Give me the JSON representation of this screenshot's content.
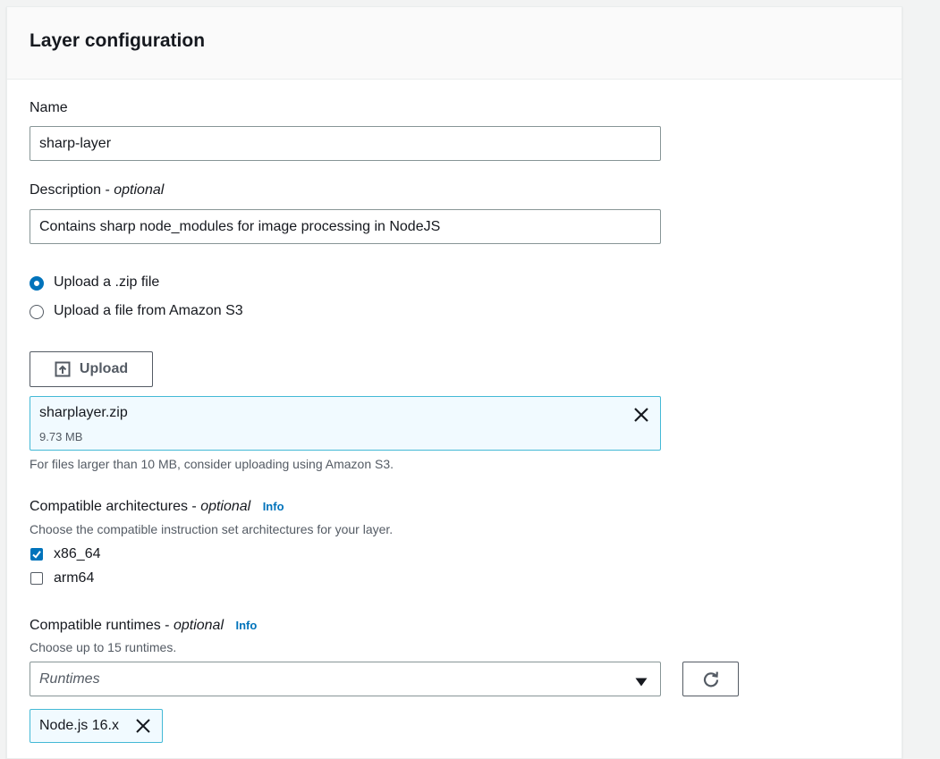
{
  "panel": {
    "title": "Layer configuration"
  },
  "name_field": {
    "label": "Name",
    "value": "sharp-layer"
  },
  "description_field": {
    "label": "Description - ",
    "optional": "optional",
    "value": "Contains sharp node_modules for image processing in NodeJS"
  },
  "upload_source": {
    "options": [
      {
        "label": "Upload a .zip file",
        "selected": true
      },
      {
        "label": "Upload a file from Amazon S3",
        "selected": false
      }
    ]
  },
  "upload_button": {
    "label": "Upload"
  },
  "uploaded_file": {
    "name": "sharplayer.zip",
    "size": "9.73 MB"
  },
  "upload_hint": "For files larger than 10 MB, consider uploading using Amazon S3.",
  "architectures": {
    "label": "Compatible architectures - ",
    "optional": "optional",
    "info": "Info",
    "description": "Choose the compatible instruction set architectures for your layer.",
    "options": [
      {
        "label": "x86_64",
        "checked": true
      },
      {
        "label": "arm64",
        "checked": false
      }
    ]
  },
  "runtimes": {
    "label": "Compatible runtimes - ",
    "optional": "optional",
    "info": "Info",
    "description": "Choose up to 15 runtimes.",
    "placeholder": "Runtimes",
    "selected": [
      "Node.js 16.x"
    ]
  },
  "colors": {
    "accent": "#0073bb",
    "token_border": "#44b9d6",
    "token_bg": "#f1faff"
  },
  "icons": {
    "upload": "upload-icon",
    "remove": "close-icon",
    "dropdown": "caret-down-icon",
    "refresh": "refresh-icon"
  }
}
